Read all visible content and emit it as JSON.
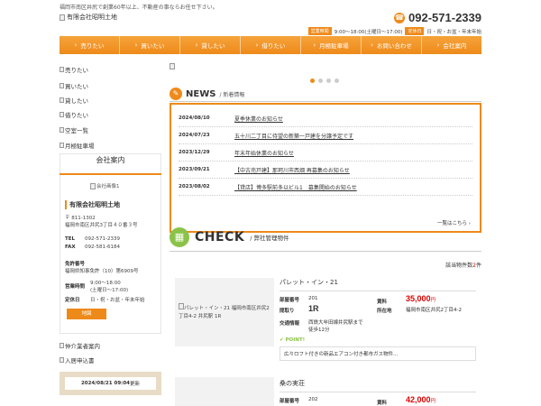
{
  "header": {
    "tagline": "福岡市南区井尻で創業60年以上、不動産の事ならお任せ下さい。",
    "logo_alt": "有限会社昭明土地",
    "phone": "092-571-2339",
    "hours_tag": "営業時間",
    "hours": "9:00～18:00(土曜日～17:00)",
    "closed_tag": "定休日",
    "closed": "日・祝・お盆・年末年始"
  },
  "nav": [
    {
      "label": "売りたい"
    },
    {
      "label": "買いたい"
    },
    {
      "label": "貸したい"
    },
    {
      "label": "借りたい"
    },
    {
      "label": "月極駐車場"
    },
    {
      "label": "お問い合わせ"
    },
    {
      "label": "会社案内"
    }
  ],
  "sidebar": {
    "links": [
      {
        "label": "売りたい"
      },
      {
        "label": "買いたい"
      },
      {
        "label": "貸したい"
      },
      {
        "label": "借りたい"
      },
      {
        "label": "空室一覧"
      },
      {
        "label": "月極駐車場"
      }
    ],
    "company": {
      "heading": "会社案内",
      "image_alt": "会社画像1",
      "name": "有限会社昭明土地",
      "postal": "〒 811-1302",
      "address": "福岡市南区井尻3丁目４０番３号",
      "tel_label": "TEL",
      "tel": "092-571-2339",
      "fax_label": "FAX",
      "fax": "092-581-6184",
      "license_label": "免許番号",
      "license": "福岡県知事免許（10）第6909号",
      "hours_label": "営業時間",
      "hours_1": "9:00～18:00",
      "hours_2": "(土曜日～17:00)",
      "closed_label": "定休日",
      "closed": "日・祝・お盆・年末年始",
      "map_button": "地図"
    },
    "links2": [
      {
        "label": "仲介業者案内"
      },
      {
        "label": "入居申込書"
      }
    ],
    "updated_date": "2024/08/21 09:04",
    "updated_suffix": "更新"
  },
  "news": {
    "title": "NEWS",
    "subtitle": "新着情報",
    "items": [
      {
        "date": "2024/08/10",
        "text": "夏季休業のお知らせ"
      },
      {
        "date": "2024/07/23",
        "text": "五十川二丁目に待望の新築一戸建を分譲予定です"
      },
      {
        "date": "2023/12/29",
        "text": "年末年始休業のお知らせ"
      },
      {
        "date": "2023/09/21",
        "text": "【中古売戸建】那珂川市西畑 再募集のお知らせ"
      },
      {
        "date": "2023/08/02",
        "text": "【貸店】博多駅前多以ビル1　募集開始のお知らせ"
      }
    ],
    "more": "一覧はこちら"
  },
  "check": {
    "title": "CHECK",
    "subtitle": "弊社管理物件",
    "count_prefix": "該当物件数",
    "count": "2",
    "count_suffix": "件"
  },
  "properties": [
    {
      "image_alt": "パレット・イン・21 福岡市南区井尻2丁目4-2 井尻駅 1R",
      "name": "パレット・イン・21",
      "room_label": "部屋番号",
      "room": "201",
      "rent_label": "賃料",
      "rent": "35,000",
      "rent_unit": "円",
      "layout_label": "間取り",
      "layout": "1R",
      "addr_label": "所在地",
      "addr": "福岡市南区井尻2丁目4-2",
      "access_label": "交通情報",
      "access": "西鉄大牟田線井尻駅まで徒歩12分",
      "point": "POINT!",
      "point_text": "広々ロフト付きの新品エアコン付き都市ガス物件…"
    },
    {
      "name": "桑の実荘",
      "room_label": "部屋番号",
      "room": "202",
      "rent_label": "賃料",
      "rent": "42,000",
      "rent_unit": "円"
    }
  ]
}
